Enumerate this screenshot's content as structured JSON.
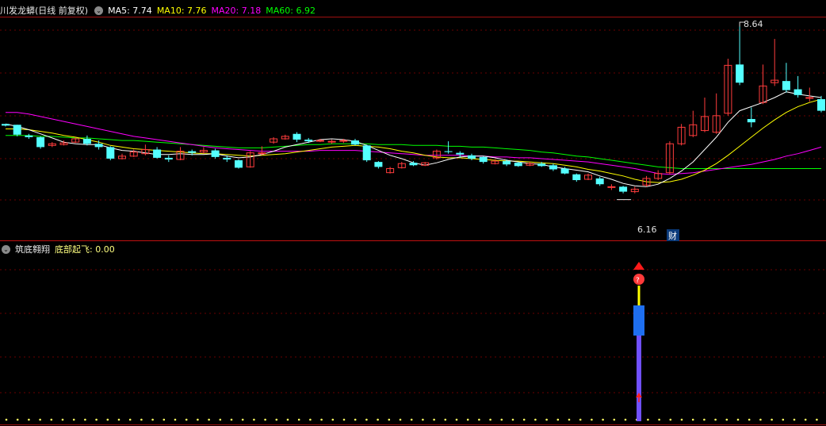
{
  "main_panel": {
    "title": "川发龙蟒(日线 前复权)",
    "indicators": [
      {
        "label": "MA5: 7.74",
        "color": "#ffffff"
      },
      {
        "label": "MA10: 7.76",
        "color": "#ffff00"
      },
      {
        "label": "MA20: 7.18",
        "color": "#ff00ff"
      },
      {
        "label": "MA60: 6.92",
        "color": "#00ff00"
      }
    ],
    "high_label": "8.64",
    "low_label": "6.16",
    "finance_tag": "财"
  },
  "sub_panel": {
    "title": "筑底翱翔",
    "indicator_label": "底部起飞: 0.00",
    "indicator_color": "#ffff80"
  },
  "colors": {
    "up": "#ff3c3c",
    "down": "#54ffff",
    "grid": "#8b0000",
    "ma5": "#ffffff",
    "ma10": "#ffff00",
    "ma20": "#ff00ff",
    "ma60": "#00ff00"
  },
  "chart_data": {
    "type": "candlestick",
    "price_range": [
      6.05,
      8.75
    ],
    "candles": [
      [
        7.46,
        7.44,
        7.46,
        7.43
      ],
      [
        7.45,
        7.33,
        7.45,
        7.31
      ],
      [
        7.32,
        7.3,
        7.34,
        7.28
      ],
      [
        7.3,
        7.18,
        7.31,
        7.16
      ],
      [
        7.2,
        7.22,
        7.24,
        7.18
      ],
      [
        7.21,
        7.23,
        7.26,
        7.2
      ],
      [
        7.24,
        7.28,
        7.3,
        7.23
      ],
      [
        7.28,
        7.22,
        7.32,
        7.2
      ],
      [
        7.22,
        7.18,
        7.26,
        7.15
      ],
      [
        7.18,
        7.04,
        7.19,
        7.02
      ],
      [
        7.04,
        7.07,
        7.1,
        7.03
      ],
      [
        7.07,
        7.12,
        7.15,
        7.06
      ],
      [
        7.1,
        7.15,
        7.21,
        7.08
      ],
      [
        7.15,
        7.05,
        7.18,
        7.04
      ],
      [
        7.05,
        7.03,
        7.08,
        7.0
      ],
      [
        7.03,
        7.13,
        7.18,
        7.02
      ],
      [
        7.13,
        7.11,
        7.15,
        7.08
      ],
      [
        7.12,
        7.14,
        7.18,
        7.1
      ],
      [
        7.14,
        7.06,
        7.16,
        7.04
      ],
      [
        7.05,
        7.03,
        7.08,
        7.0
      ],
      [
        7.02,
        6.93,
        7.03,
        6.92
      ],
      [
        6.94,
        7.11,
        7.13,
        6.93
      ],
      [
        7.1,
        7.11,
        7.19,
        7.08
      ],
      [
        7.24,
        7.28,
        7.3,
        7.22
      ],
      [
        7.28,
        7.31,
        7.33,
        7.27
      ],
      [
        7.34,
        7.27,
        7.36,
        7.24
      ],
      [
        7.27,
        7.25,
        7.29,
        7.23
      ],
      [
        7.26,
        7.26,
        7.28,
        7.24
      ],
      [
        7.24,
        7.25,
        7.27,
        7.22
      ],
      [
        7.26,
        7.26,
        7.28,
        7.23
      ],
      [
        7.26,
        7.21,
        7.28,
        7.2
      ],
      [
        7.2,
        7.02,
        7.21,
        7.0
      ],
      [
        7.0,
        6.94,
        7.01,
        6.92
      ],
      [
        6.87,
        6.92,
        6.94,
        6.86
      ],
      [
        6.93,
        6.98,
        7.0,
        6.92
      ],
      [
        6.99,
        6.96,
        7.01,
        6.95
      ],
      [
        6.96,
        6.99,
        7.0,
        6.95
      ],
      [
        7.05,
        7.13,
        7.15,
        7.03
      ],
      [
        7.13,
        7.12,
        7.25,
        7.1
      ],
      [
        7.11,
        7.09,
        7.13,
        7.05
      ],
      [
        7.08,
        7.04,
        7.1,
        7.02
      ],
      [
        7.06,
        7.0,
        7.07,
        6.98
      ],
      [
        6.98,
        7.01,
        7.03,
        6.97
      ],
      [
        7.01,
        6.97,
        7.03,
        6.95
      ],
      [
        6.99,
        6.95,
        7.0,
        6.94
      ],
      [
        6.96,
        6.98,
        7.0,
        6.95
      ],
      [
        6.98,
        6.95,
        7.0,
        6.94
      ],
      [
        6.96,
        6.91,
        6.98,
        6.89
      ],
      [
        6.92,
        6.86,
        6.94,
        6.85
      ],
      [
        6.85,
        6.78,
        6.86,
        6.76
      ],
      [
        6.79,
        6.84,
        6.86,
        6.78
      ],
      [
        6.8,
        6.73,
        6.82,
        6.71
      ],
      [
        6.7,
        6.7,
        6.73,
        6.66
      ],
      [
        6.7,
        6.64,
        6.71,
        6.62
      ],
      [
        6.64,
        6.67,
        6.7,
        6.62
      ],
      [
        6.72,
        6.8,
        6.83,
        6.7
      ],
      [
        6.8,
        6.86,
        6.9,
        6.78
      ],
      [
        6.87,
        7.22,
        7.25,
        6.85
      ],
      [
        7.22,
        7.42,
        7.46,
        7.2
      ],
      [
        7.32,
        7.45,
        7.62,
        7.3
      ],
      [
        7.38,
        7.55,
        7.78,
        7.36
      ],
      [
        7.36,
        7.56,
        7.83,
        7.34
      ],
      [
        7.59,
        8.17,
        8.25,
        7.56
      ],
      [
        8.18,
        7.96,
        8.64,
        7.93
      ],
      [
        7.52,
        7.48,
        7.66,
        7.42
      ],
      [
        7.72,
        7.92,
        8.18,
        7.7
      ],
      [
        7.96,
        7.99,
        8.49,
        7.92
      ],
      [
        7.98,
        7.87,
        8.2,
        7.84
      ],
      [
        7.88,
        7.81,
        8.04,
        7.78
      ],
      [
        7.78,
        7.78,
        7.9,
        7.73
      ],
      [
        7.76,
        7.62,
        7.8,
        7.6
      ]
    ],
    "ma5": [
      7.46,
      7.43,
      7.39,
      7.34,
      7.29,
      7.24,
      7.22,
      7.21,
      7.21,
      7.17,
      7.14,
      7.13,
      7.11,
      7.09,
      7.09,
      7.1,
      7.09,
      7.09,
      7.1,
      7.07,
      7.05,
      7.06,
      7.09,
      7.13,
      7.18,
      7.21,
      7.24,
      7.27,
      7.28,
      7.27,
      7.25,
      7.2,
      7.14,
      7.08,
      7.04,
      6.99,
      6.96,
      6.99,
      7.03,
      7.06,
      7.07,
      7.07,
      7.05,
      7.02,
      7.0,
      6.98,
      6.97,
      6.94,
      6.92,
      6.9,
      6.88,
      6.83,
      6.79,
      6.74,
      6.71,
      6.7,
      6.73,
      6.8,
      6.89,
      7.0,
      7.15,
      7.3,
      7.48,
      7.62,
      7.67,
      7.72,
      7.78,
      7.85,
      7.82,
      7.8,
      7.78
    ],
    "ma10": [
      7.4,
      7.4,
      7.39,
      7.37,
      7.35,
      7.32,
      7.3,
      7.27,
      7.24,
      7.2,
      7.18,
      7.16,
      7.15,
      7.14,
      7.13,
      7.12,
      7.11,
      7.1,
      7.1,
      7.09,
      7.08,
      7.07,
      7.08,
      7.09,
      7.1,
      7.12,
      7.14,
      7.16,
      7.18,
      7.19,
      7.2,
      7.19,
      7.18,
      7.16,
      7.13,
      7.11,
      7.08,
      7.06,
      7.05,
      7.05,
      7.04,
      7.03,
      7.02,
      7.01,
      7.01,
      7.0,
      6.99,
      6.98,
      6.96,
      6.94,
      6.91,
      6.89,
      6.86,
      6.83,
      6.79,
      6.76,
      6.75,
      6.76,
      6.79,
      6.84,
      6.9,
      6.98,
      7.08,
      7.19,
      7.3,
      7.41,
      7.51,
      7.6,
      7.67,
      7.72,
      7.76
    ],
    "ma20": [
      7.6,
      7.6,
      7.58,
      7.55,
      7.52,
      7.49,
      7.46,
      7.43,
      7.4,
      7.37,
      7.34,
      7.31,
      7.29,
      7.27,
      7.25,
      7.23,
      7.21,
      7.19,
      7.17,
      7.16,
      7.15,
      7.14,
      7.13,
      7.13,
      7.13,
      7.13,
      7.13,
      7.14,
      7.14,
      7.14,
      7.14,
      7.13,
      7.12,
      7.11,
      7.1,
      7.09,
      7.08,
      7.08,
      7.08,
      7.08,
      7.07,
      7.07,
      7.06,
      7.06,
      7.05,
      7.05,
      7.04,
      7.03,
      7.02,
      7.01,
      7.0,
      6.98,
      6.96,
      6.94,
      6.92,
      6.89,
      6.86,
      6.85,
      6.86,
      6.87,
      6.89,
      6.91,
      6.93,
      6.95,
      6.97,
      7.0,
      7.03,
      7.07,
      7.1,
      7.14,
      7.18
    ],
    "ma60": [
      7.32,
      7.32,
      7.32,
      7.31,
      7.31,
      7.3,
      7.29,
      7.29,
      7.28,
      7.27,
      7.26,
      7.26,
      7.25,
      7.24,
      7.23,
      7.22,
      7.21,
      7.2,
      7.19,
      7.18,
      7.17,
      7.17,
      7.17,
      7.18,
      7.19,
      7.2,
      7.21,
      7.21,
      7.22,
      7.22,
      7.22,
      7.22,
      7.21,
      7.21,
      7.21,
      7.2,
      7.2,
      7.2,
      7.19,
      7.19,
      7.18,
      7.18,
      7.17,
      7.16,
      7.15,
      7.14,
      7.12,
      7.11,
      7.09,
      7.07,
      7.06,
      7.04,
      7.02,
      7.0,
      6.98,
      6.96,
      6.94,
      6.93,
      6.92,
      6.92,
      6.92,
      6.92,
      6.92,
      6.92,
      6.92,
      6.92,
      6.92,
      6.92,
      6.92,
      6.92,
      6.92
    ]
  }
}
